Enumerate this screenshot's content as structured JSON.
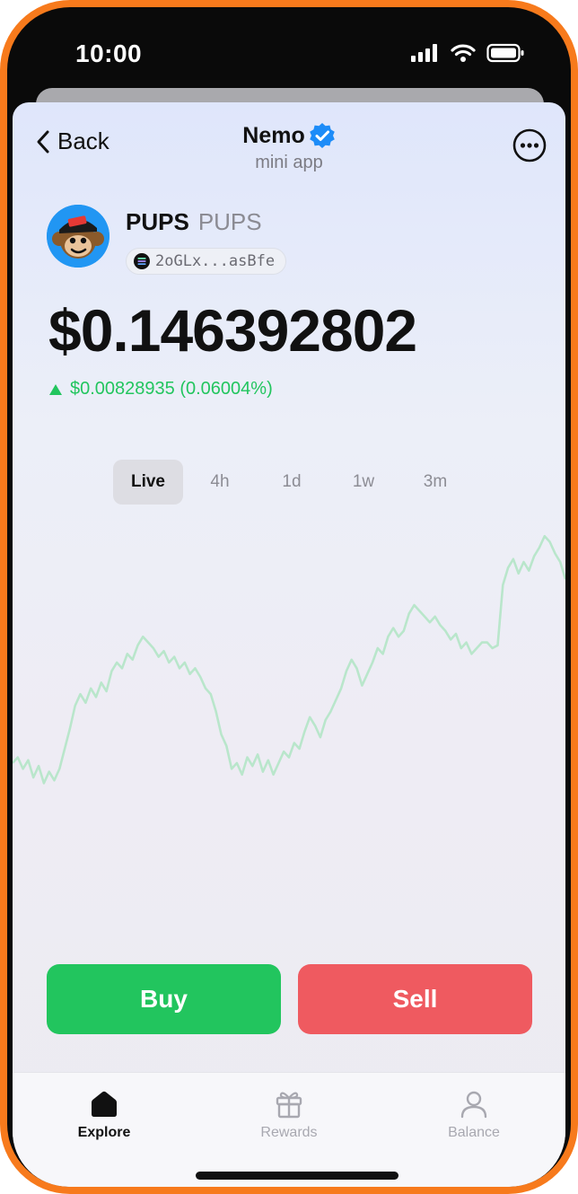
{
  "status_bar": {
    "time": "10:00"
  },
  "nav": {
    "back_label": "Back",
    "title": "Nemo",
    "subtitle": "mini app",
    "verified_color": "#1d8cf8"
  },
  "token": {
    "name": "PUPS",
    "symbol": "PUPS",
    "address_short": "2oGLx...asBfe"
  },
  "price": {
    "value": "$0.146392802",
    "change": "$0.00828935 (0.06004%)",
    "direction": "up",
    "change_color": "#22c55e"
  },
  "time_ranges": {
    "options": [
      "Live",
      "4h",
      "1d",
      "1w",
      "3m"
    ],
    "selected": "Live"
  },
  "chart_data": {
    "type": "line",
    "line_color": "#b9e6cb",
    "grid": false,
    "axes_visible": false,
    "ylim": [
      0,
      100
    ],
    "series": [
      {
        "values": [
          20,
          22,
          18,
          21,
          15,
          19,
          13,
          17,
          14,
          18,
          25,
          32,
          40,
          44,
          41,
          46,
          43,
          48,
          45,
          52,
          55,
          53,
          58,
          56,
          61,
          64,
          62,
          60,
          57,
          59,
          55,
          57,
          53,
          55,
          51,
          53,
          50,
          46,
          44,
          38,
          30,
          26,
          18,
          20,
          16,
          22,
          19,
          23,
          17,
          21,
          16,
          20,
          24,
          22,
          27,
          25,
          31,
          36,
          33,
          29,
          35,
          38,
          42,
          46,
          52,
          56,
          53,
          47,
          51,
          55,
          60,
          58,
          64,
          67,
          64,
          66,
          72,
          75,
          73,
          71,
          69,
          71,
          68,
          66,
          63,
          65,
          60,
          62,
          58,
          60,
          62,
          62,
          60,
          61,
          82,
          88,
          91,
          86,
          90,
          87,
          92,
          95,
          99,
          97,
          93,
          90,
          84
        ]
      }
    ]
  },
  "actions": {
    "buy_label": "Buy",
    "sell_label": "Sell"
  },
  "tabbar": {
    "items": [
      {
        "label": "Explore",
        "icon": "home-icon",
        "active": true
      },
      {
        "label": "Rewards",
        "icon": "gift-icon",
        "active": false
      },
      {
        "label": "Balance",
        "icon": "person-icon",
        "active": false
      }
    ]
  }
}
